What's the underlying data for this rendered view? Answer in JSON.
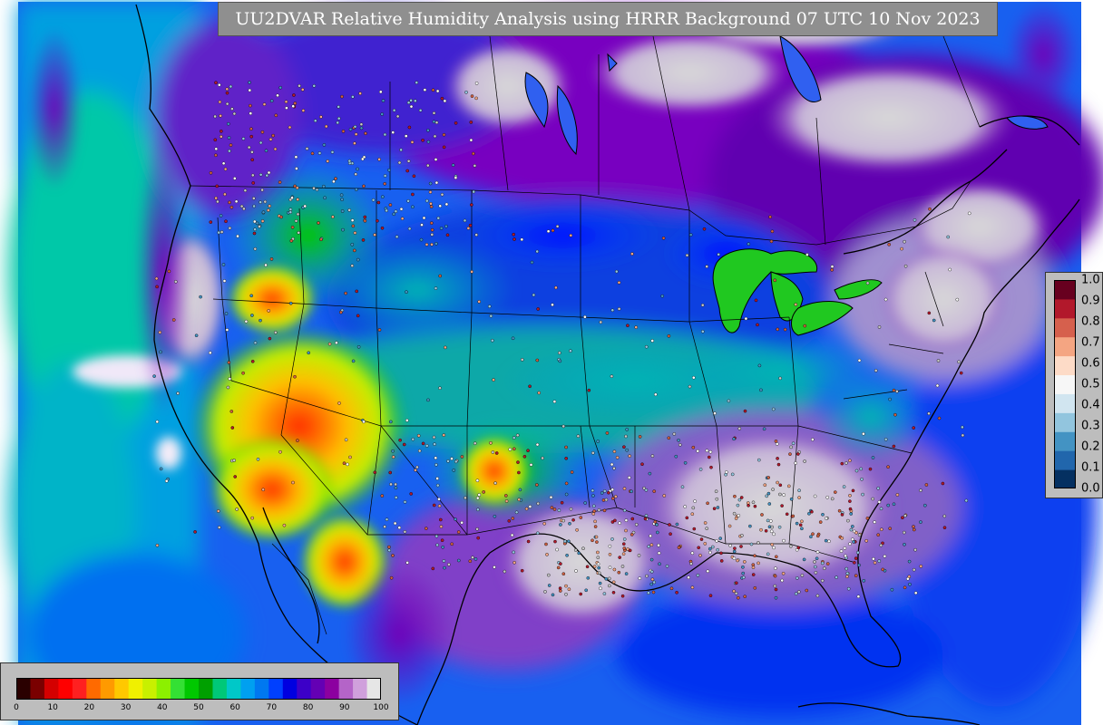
{
  "map": {
    "title": "UU2DVAR Relative Humidity Analysis using HRRR Background 07 UTC 10 Nov 2023",
    "background_color": "#ffffff",
    "land_fill_description": "relative humidity field over North America",
    "border_color": "#000000"
  },
  "horizontal_colorbar": {
    "tick_labels": [
      "0",
      "10",
      "20",
      "30",
      "40",
      "50",
      "60",
      "70",
      "80",
      "90",
      "100"
    ],
    "colors": [
      "#2a0000",
      "#7a0000",
      "#d40000",
      "#ff0000",
      "#ff2020",
      "#ff6a00",
      "#ff9a00",
      "#ffc800",
      "#f0f000",
      "#c8f000",
      "#8cf000",
      "#34e034",
      "#00c800",
      "#00a000",
      "#00c878",
      "#00c8c8",
      "#00a0f0",
      "#0078f0",
      "#0040ff",
      "#0000e0",
      "#3c00c8",
      "#6400b4",
      "#8c00a0",
      "#b464c8",
      "#d0a0dc",
      "#e6e6e6"
    ]
  },
  "vertical_colorbar": {
    "tick_labels": [
      "0.0",
      "0.1",
      "0.2",
      "0.3",
      "0.4",
      "0.5",
      "0.6",
      "0.7",
      "0.8",
      "0.9",
      "1.0"
    ],
    "colors": [
      "#053061",
      "#2166ac",
      "#4393c3",
      "#92c5de",
      "#d1e5f0",
      "#f7f7f7",
      "#fddbc7",
      "#f4a582",
      "#d6604d",
      "#b2182b",
      "#67001f"
    ]
  }
}
